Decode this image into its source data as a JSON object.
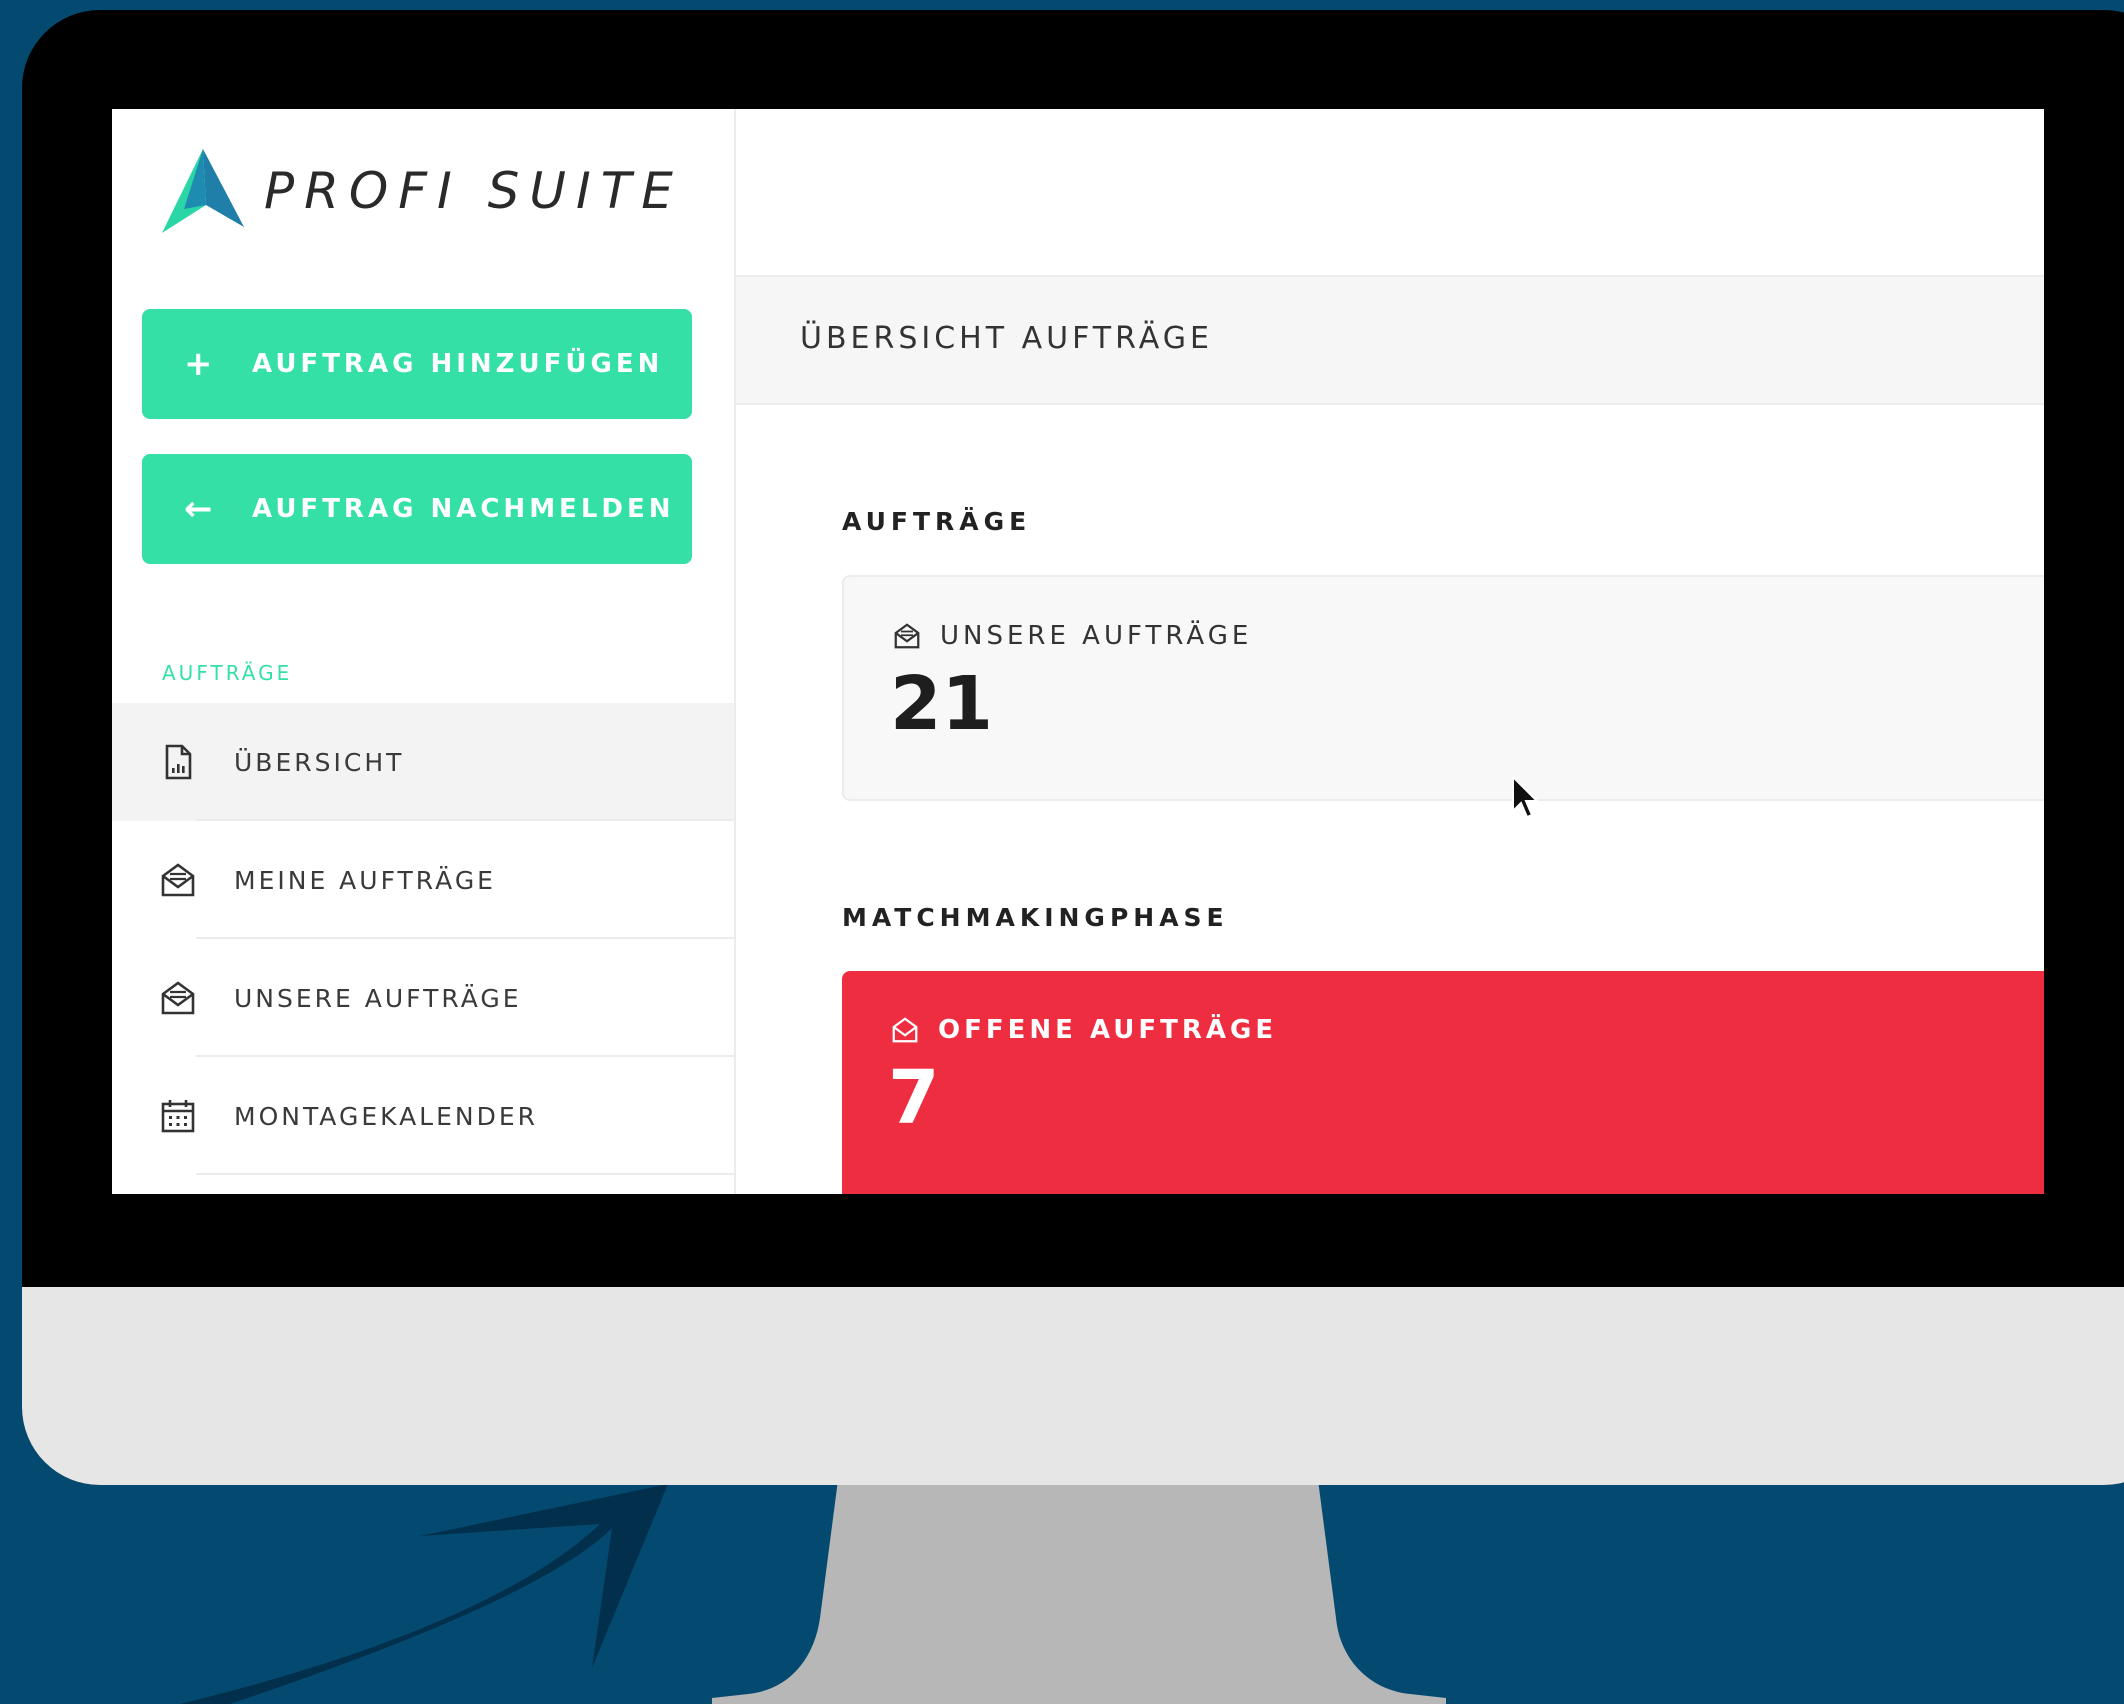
{
  "colors": {
    "background": "#044a70",
    "accent": "#35e0a6",
    "danger": "#ef2d41",
    "bezel": "#000000",
    "chin": "#e6e6e6",
    "stand": "#b7b7b7"
  },
  "app": {
    "logo_text": "PROFI SUITE",
    "logo_icon": "mountain-logo-icon"
  },
  "sidebar": {
    "add_order_label": "AUFTRAG HINZUFÜGEN",
    "add_order_icon": "plus-icon",
    "report_order_label": "AUFTRAG NACHMELDEN",
    "report_order_icon": "arrow-left-icon",
    "section_label": "AUFTRÄGE",
    "items": [
      {
        "label": "ÜBERSICHT",
        "icon": "report-document-icon",
        "active": true
      },
      {
        "label": "MEINE AUFTRÄGE",
        "icon": "open-envelope-icon",
        "active": false
      },
      {
        "label": "UNSERE AUFTRÄGE",
        "icon": "open-envelope-icon",
        "active": false
      },
      {
        "label": "MONTAGEKALENDER",
        "icon": "calendar-icon",
        "active": false
      }
    ]
  },
  "main": {
    "breadcrumb_title": "ÜBERSICHT AUFTRÄGE",
    "orders_heading": "AUFTRÄGE",
    "our_orders_card": {
      "label": "UNSERE AUFTRÄGE",
      "value": "21",
      "icon": "open-envelope-icon"
    },
    "matchmaking_heading": "MATCHMAKINGPHASE",
    "open_orders_card": {
      "label": "OFFENE AUFTRÄGE",
      "value": "7",
      "icon": "open-envelope-icon"
    }
  }
}
